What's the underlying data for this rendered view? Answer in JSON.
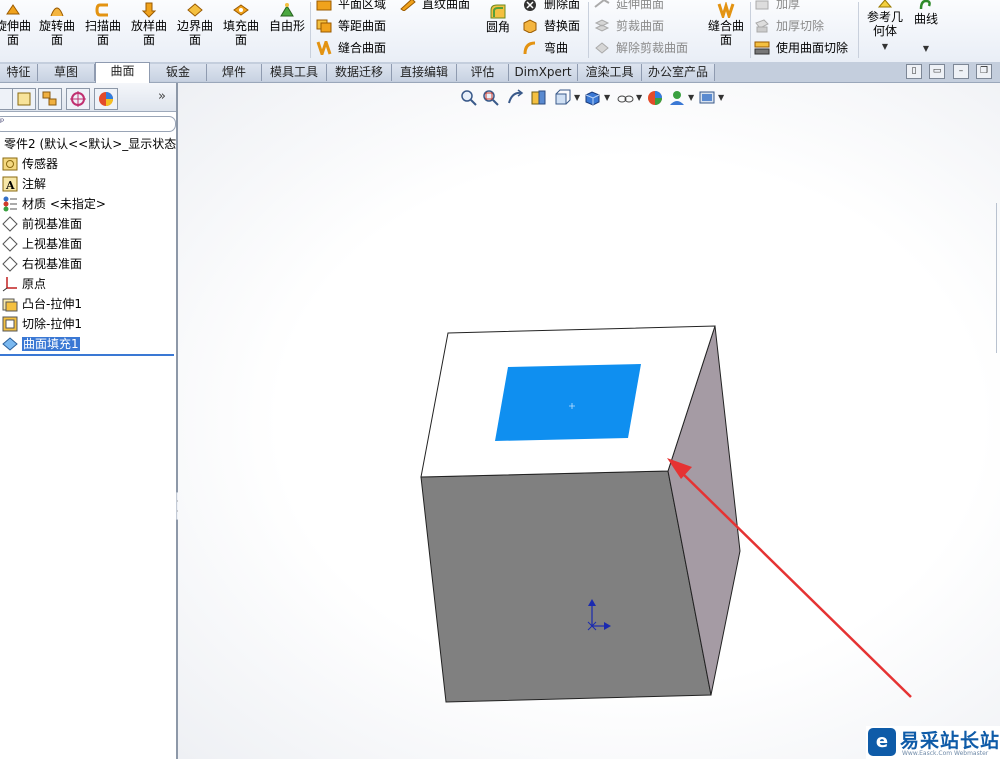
{
  "ribbon": {
    "big_buttons": [
      {
        "l1": "旋伸曲",
        "l2": "面"
      },
      {
        "l1": "旋转曲",
        "l2": "面"
      },
      {
        "l1": "扫描曲",
        "l2": "面"
      },
      {
        "l1": "放样曲",
        "l2": "面"
      },
      {
        "l1": "边界曲",
        "l2": "面"
      },
      {
        "l1": "填充曲",
        "l2": "面"
      },
      {
        "l1": "自由形",
        "l2": ""
      }
    ],
    "col1": [
      "平面区域",
      "等距曲面",
      "缝合曲面"
    ],
    "col2_top": "直纹曲面",
    "fillet": "圆角",
    "col3": [
      "删除面",
      "替换面",
      "弯曲"
    ],
    "col4": [
      "延伸曲面",
      "剪裁曲面",
      "解除剪裁曲面"
    ],
    "knit_big": {
      "l1": "缝合曲",
      "l2": "面"
    },
    "col5": [
      "加厚",
      "加厚切除",
      "使用曲面切除"
    ],
    "ref_geom": {
      "l1": "参考几",
      "l2": "何体"
    },
    "curves": "曲线"
  },
  "tabs": [
    "特征",
    "草图",
    "曲面",
    "钣金",
    "焊件",
    "模具工具",
    "数据迁移",
    "直接编辑",
    "评估",
    "DimXpert",
    "渲染工具",
    "办公室产品"
  ],
  "active_tab": "曲面",
  "tree": {
    "root": "零件2  (默认<<默认>_显示状态",
    "items": [
      "传感器",
      "注解",
      "材质 <未指定>",
      "前视基准面",
      "上视基准面",
      "右视基准面",
      "原点",
      "凸台-拉伸1",
      "切除-拉伸1",
      "曲面填充1"
    ],
    "selected_index": 9
  },
  "colors": {
    "ribbon_bg": "#eef2f8",
    "tab_active_bg": "#ffffff",
    "selection": "#3a78d4",
    "fill_face": "#0f8ff0",
    "cube_front": "#808080",
    "cube_side": "#a59ba4",
    "arrow": "#e53333"
  },
  "icons": [
    "zoom-fit-icon",
    "zoom-area-icon",
    "previous-view-icon",
    "section-view-icon",
    "view-orientation-icon",
    "display-style-icon",
    "hide-show-icon",
    "appearance-icon",
    "scene-icon",
    "view-settings-icon"
  ],
  "watermark": {
    "logo": "e",
    "title": "易采站长站",
    "sub": "Www.Easck.Com Webmaster"
  }
}
